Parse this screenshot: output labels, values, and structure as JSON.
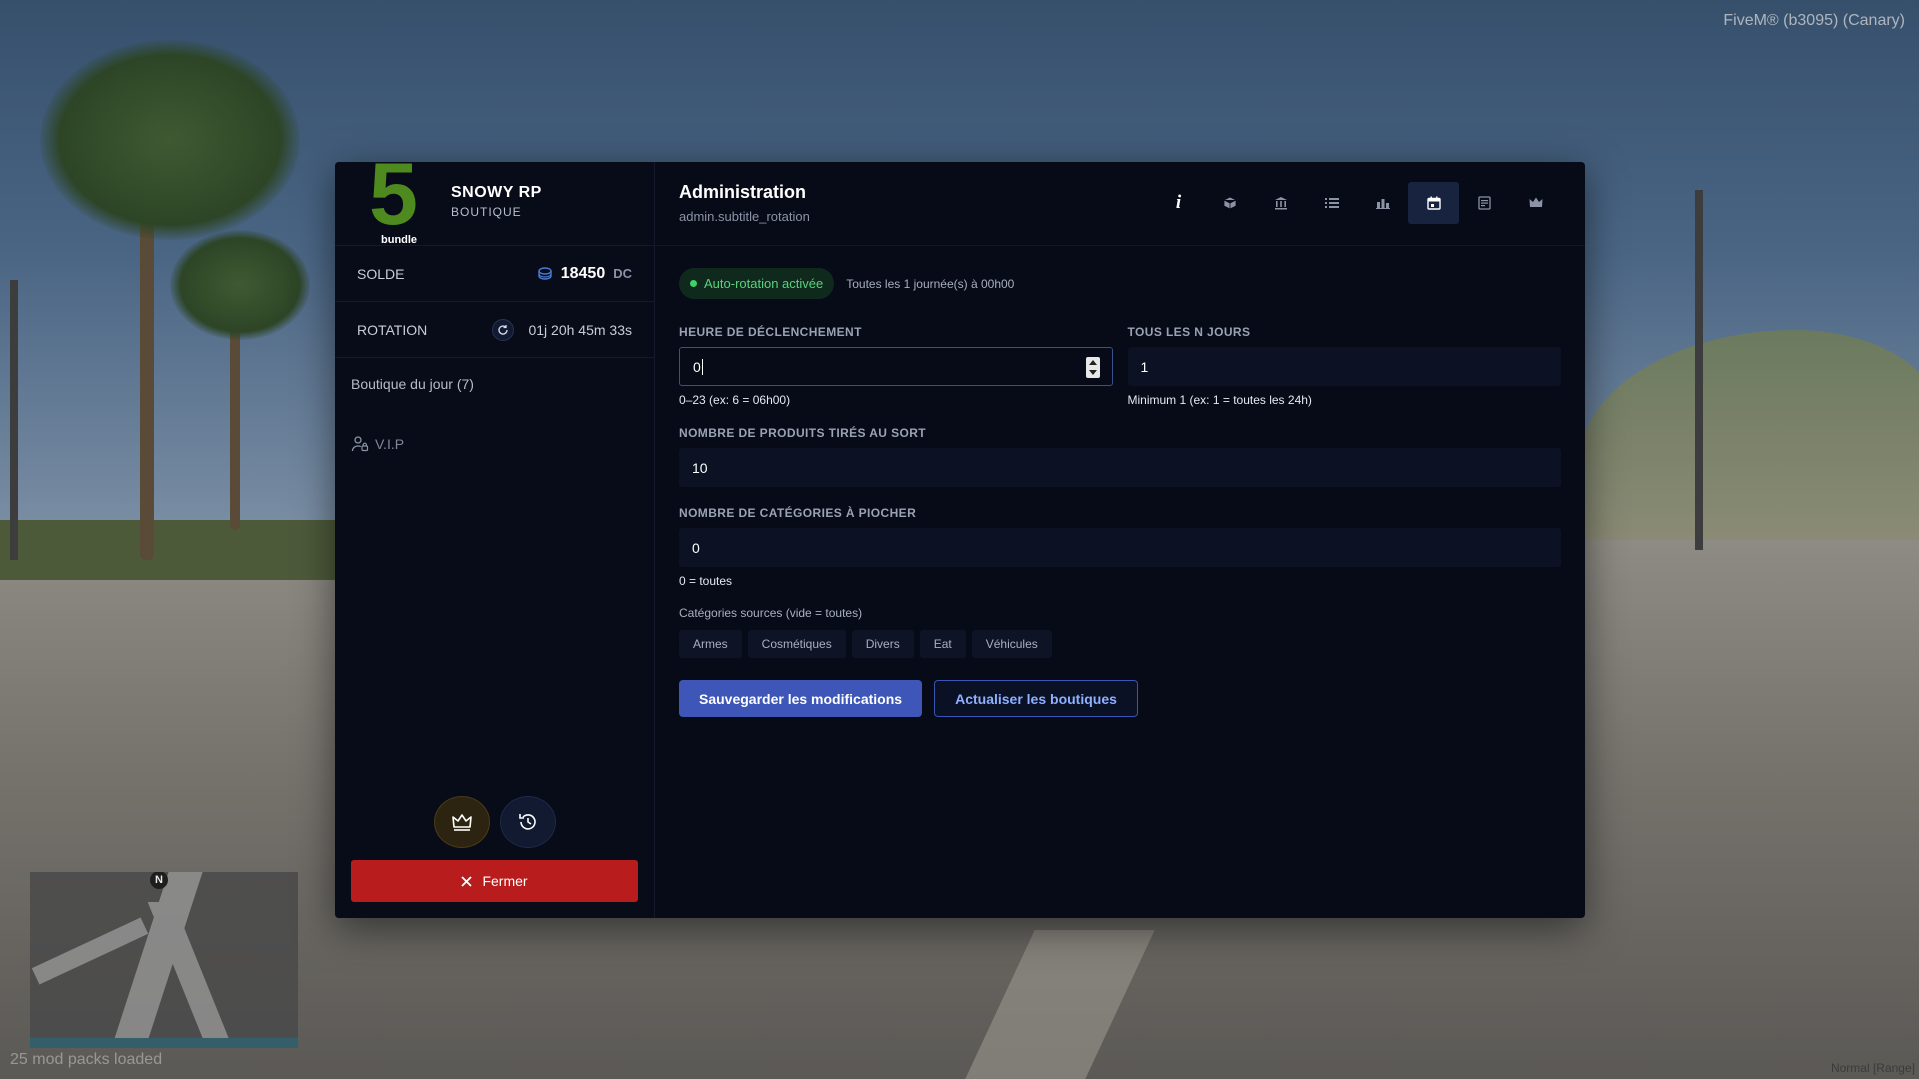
{
  "hud": {
    "title": "FiveM® (b3095) (Canary)",
    "mods_loaded": "25 mod packs loaded",
    "mode": "Normal [Range]",
    "minimap_north": "N"
  },
  "brand": {
    "logo_number": "5",
    "logo_word": "bundle",
    "name": "SNOWY RP",
    "subtitle": "BOUTIQUE"
  },
  "sidebar": {
    "balance_label": "SOLDE",
    "balance_value": "18450",
    "balance_unit": "DC",
    "rotation_label": "ROTATION",
    "rotation_value": "01j 20h 45m 33s",
    "shop_of_day": "Boutique du jour (7)",
    "vip": "V.I.P",
    "close_label": "Fermer"
  },
  "header": {
    "title": "Administration",
    "subtitle": "admin.subtitle_rotation",
    "tabs": [
      {
        "icon": "info-icon",
        "active": false
      },
      {
        "icon": "box-icon",
        "active": false
      },
      {
        "icon": "bank-icon",
        "active": false
      },
      {
        "icon": "list-icon",
        "active": false
      },
      {
        "icon": "chart-icon",
        "active": false
      },
      {
        "icon": "calendar-icon",
        "active": true
      },
      {
        "icon": "document-icon",
        "active": false
      },
      {
        "icon": "crown-icon",
        "active": false
      }
    ]
  },
  "status": {
    "badge": "Auto-rotation activée",
    "schedule": "Toutes les 1 journée(s) à 00h00"
  },
  "form": {
    "trigger_hour_label": "HEURE DE DÉCLENCHEMENT",
    "trigger_hour_value": "0",
    "trigger_hour_hint": "0–23 (ex: 6 = 06h00)",
    "every_n_days_label": "TOUS LES N JOURS",
    "every_n_days_value": "1",
    "every_n_days_hint": "Minimum 1 (ex: 1 = toutes les 24h)",
    "products_label": "NOMBRE DE PRODUITS TIRÉS AU SORT",
    "products_value": "10",
    "categories_label": "NOMBRE DE CATÉGORIES À PIOCHER",
    "categories_value": "0",
    "categories_hint": "0 = toutes",
    "sources_label": "Catégories sources (vide = toutes)",
    "sources": [
      "Armes",
      "Cosmétiques",
      "Divers",
      "Eat",
      "Véhicules"
    ]
  },
  "actions": {
    "save": "Sauvegarder les modifications",
    "refresh": "Actualiser les boutiques"
  },
  "colors": {
    "panel_bg": "#070b18",
    "accent_blue": "#3d56b8",
    "success_green": "#58d27c",
    "danger_red": "#b81c1c",
    "logo_green": "#4e8a1e"
  }
}
